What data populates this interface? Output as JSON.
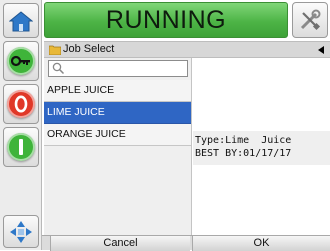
{
  "header": {
    "status": "RUNNING",
    "status_color": "#4db446"
  },
  "rail": {
    "buttons": [
      {
        "name": "home",
        "icon": "home-icon"
      },
      {
        "name": "login",
        "icon": "key-icon"
      },
      {
        "name": "stop",
        "icon": "stop-icon"
      },
      {
        "name": "start",
        "icon": "start-icon"
      },
      {
        "name": "navigate",
        "icon": "directional-pad-icon"
      }
    ]
  },
  "tools_icon": "tools-icon",
  "title_strip": {
    "title": "Job Select"
  },
  "search": {
    "value": ""
  },
  "jobs": [
    {
      "label": "APPLE JUICE",
      "selected": false
    },
    {
      "label": "LIME JUICE",
      "selected": true
    },
    {
      "label": "ORANGE JUICE",
      "selected": false
    }
  ],
  "preview": {
    "line1": "Type:Lime  Juice",
    "line2": "BEST BY:01/17/17"
  },
  "footer": {
    "cancel_label": "Cancel",
    "ok_label": "OK"
  },
  "colors": {
    "selection": "#2f66c4",
    "stop": "#e03828",
    "start": "#3fb43a"
  }
}
